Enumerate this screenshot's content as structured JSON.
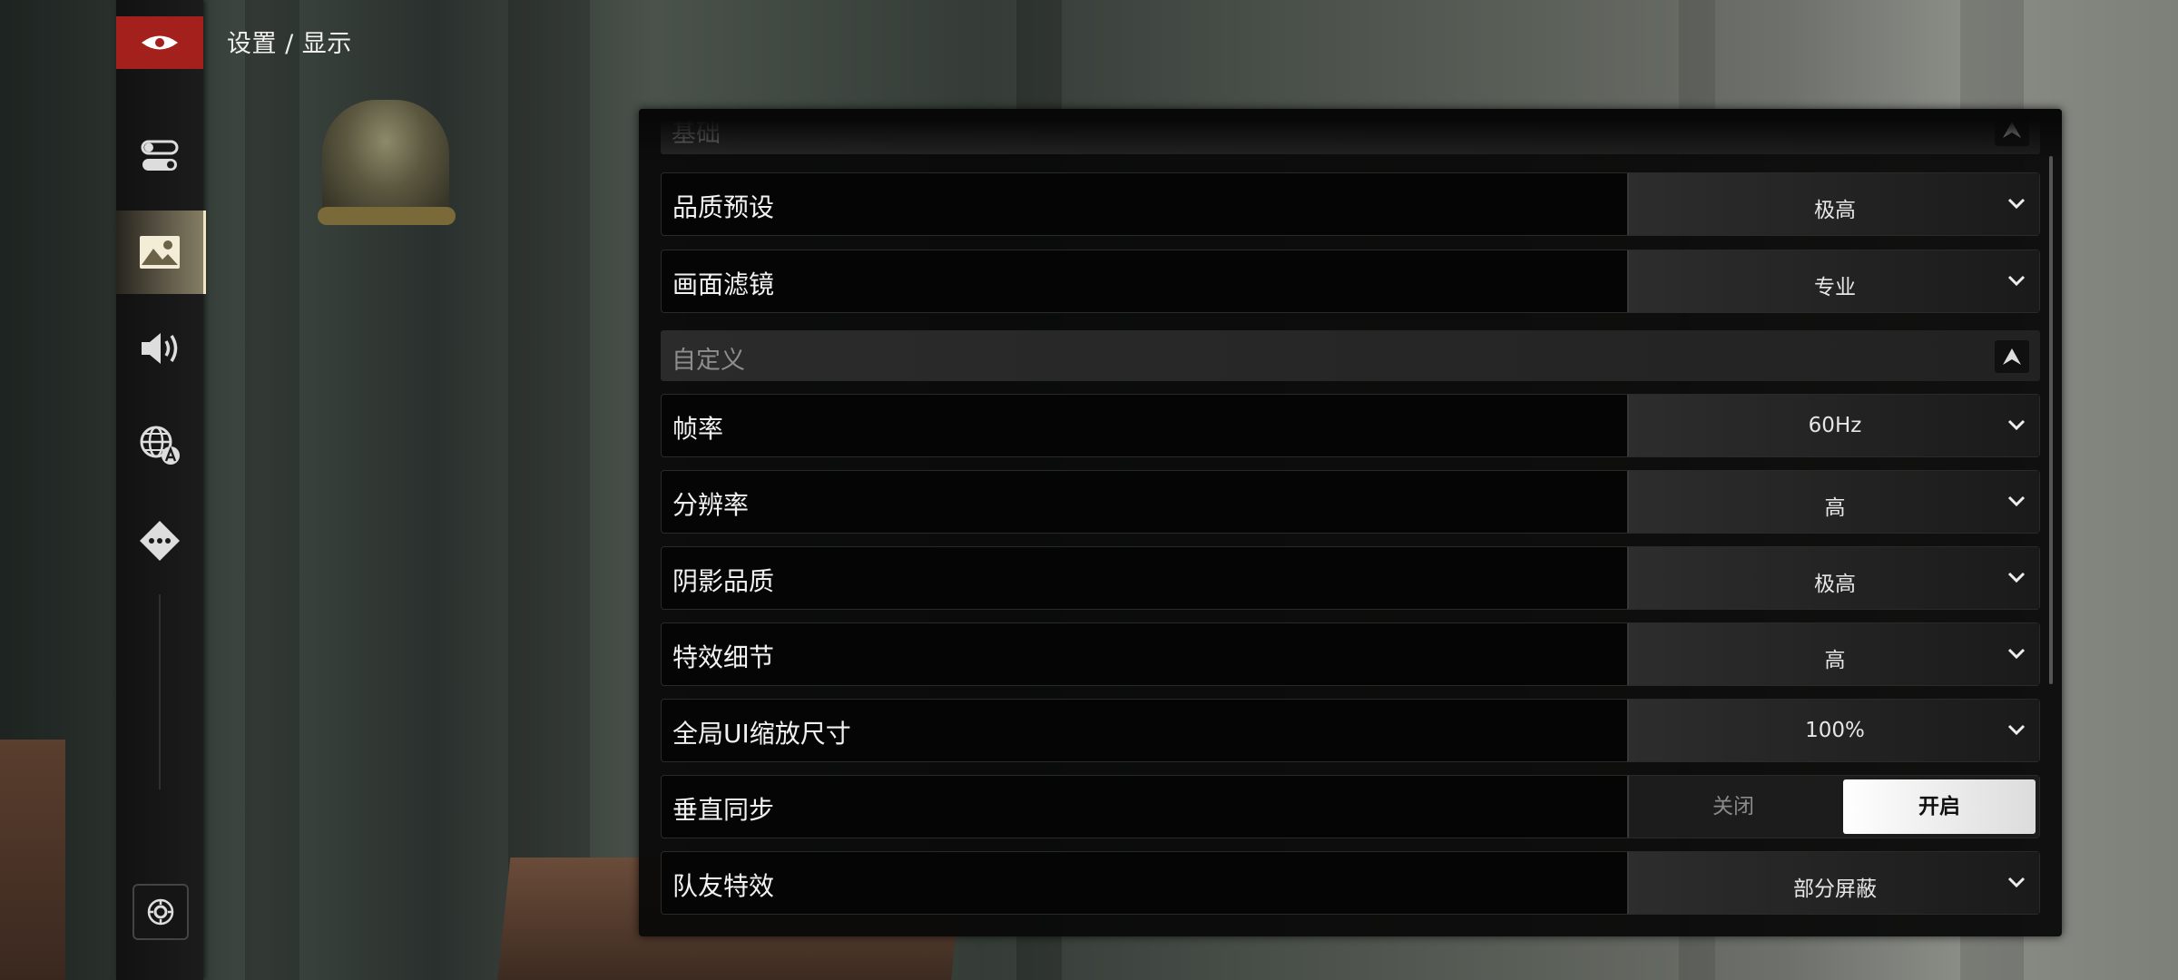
{
  "breadcrumb": "设置 / 显示",
  "sidebar": {
    "items": [
      {
        "name": "toggles-icon",
        "active": false
      },
      {
        "name": "display-image-icon",
        "active": true
      },
      {
        "name": "speaker-icon",
        "active": false
      },
      {
        "name": "language-globe-icon",
        "active": false
      },
      {
        "name": "more-dpad-icon",
        "active": false
      }
    ]
  },
  "sections": {
    "basic": {
      "title": "基础"
    },
    "custom": {
      "title": "自定义"
    }
  },
  "rows": {
    "quality_preset": {
      "label": "品质预设",
      "value": "极高"
    },
    "image_filter": {
      "label": "画面滤镜",
      "value": "专业"
    },
    "frame_rate": {
      "label": "帧率",
      "value": "60Hz"
    },
    "resolution": {
      "label": "分辨率",
      "value": "高"
    },
    "shadow_quality": {
      "label": "阴影品质",
      "value": "极高"
    },
    "effect_detail": {
      "label": "特效细节",
      "value": "高"
    },
    "ui_scale": {
      "label": "全局UI缩放尺寸",
      "value": "100%"
    },
    "vsync": {
      "label": "垂直同步",
      "off_label": "关闭",
      "on_label": "开启",
      "selected": "on"
    },
    "teammate_effects": {
      "label": "队友特效",
      "value": "部分屏蔽"
    }
  },
  "colors": {
    "accent": "#a3201d",
    "panel": "#080808",
    "toggle_on": "#ffffff"
  }
}
